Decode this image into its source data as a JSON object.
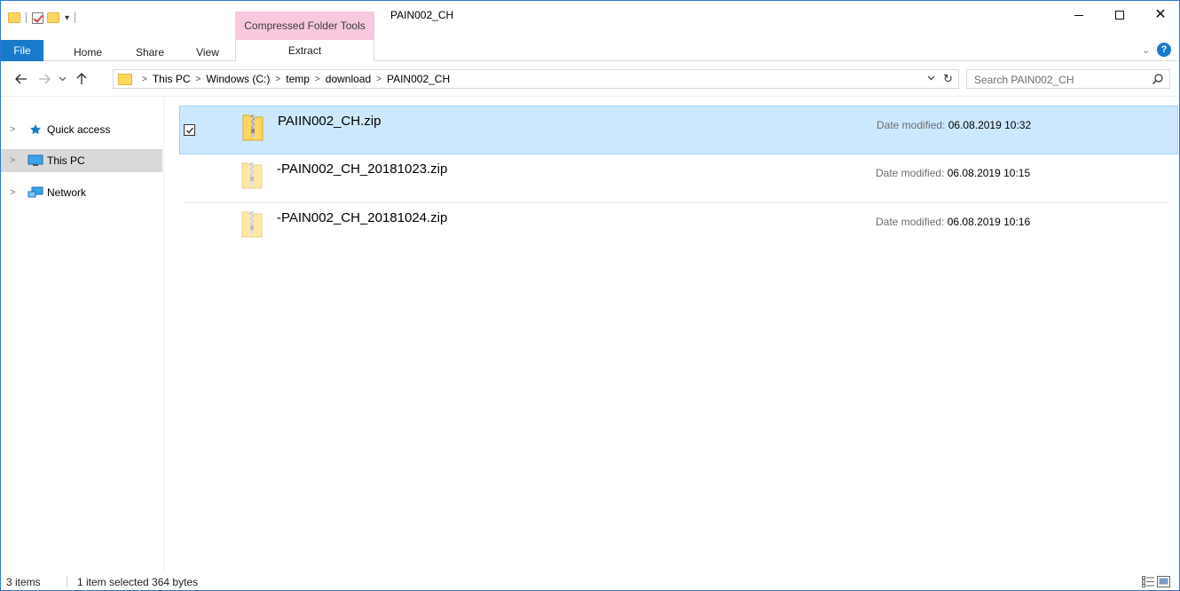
{
  "window": {
    "title": "PAIN002_CH",
    "context_tab_group": "Compressed Folder Tools",
    "controls": [
      "minimize",
      "maximize",
      "close"
    ]
  },
  "ribbon": {
    "tabs": {
      "file": "File",
      "home": "Home",
      "share": "Share",
      "view": "View",
      "extract": "Extract"
    },
    "help_label": "?"
  },
  "address_bar": {
    "crumbs": [
      "This PC",
      "Windows (C:)",
      "temp",
      "download",
      "PAIN002_CH"
    ]
  },
  "search": {
    "placeholder": "Search PAIN002_CH"
  },
  "nav_pane": {
    "items": [
      {
        "label": "Quick access",
        "icon": "star-icon"
      },
      {
        "label": "This PC",
        "icon": "computer-icon",
        "selected": true
      },
      {
        "label": "Network",
        "icon": "network-icon"
      }
    ]
  },
  "files": [
    {
      "name": "PAIIN002_CH.zip",
      "date_label": "Date modified: ",
      "date_value": "06.08.2019 10:32",
      "selected": true
    },
    {
      "name": "-PAIN002_CH_20181023.zip",
      "date_label": "Date modified: ",
      "date_value": "06.08.2019 10:15",
      "selected": false
    },
    {
      "name": "-PAIN002_CH_20181024.zip",
      "date_label": "Date modified: ",
      "date_value": "06.08.2019 10:16",
      "selected": false
    }
  ],
  "status_bar": {
    "items_count": "3 items",
    "selection": "1 item selected  364 bytes"
  },
  "colors": {
    "accent": "#1979ca",
    "selection_bg": "#cce8ff",
    "selection_border": "#99d1ff",
    "context_tab": "#f8c8df",
    "folder": "#ffd75e"
  }
}
